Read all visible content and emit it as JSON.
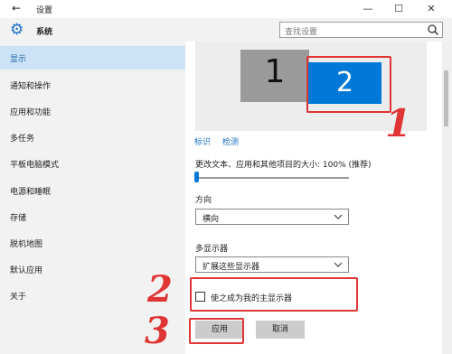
{
  "window": {
    "title": "设置",
    "back_glyph": "←",
    "min_glyph": "—",
    "max_glyph": "☐",
    "close_glyph": "✕"
  },
  "header": {
    "page_title": "系统",
    "gear_glyph": "⚙"
  },
  "search": {
    "placeholder": "查找设置"
  },
  "sidebar": {
    "items": [
      {
        "label": "显示",
        "active": true
      },
      {
        "label": "通知和操作",
        "active": false
      },
      {
        "label": "应用和功能",
        "active": false
      },
      {
        "label": "多任务",
        "active": false
      },
      {
        "label": "平板电脑模式",
        "active": false
      },
      {
        "label": "电源和睡眠",
        "active": false
      },
      {
        "label": "存储",
        "active": false
      },
      {
        "label": "脱机地图",
        "active": false
      },
      {
        "label": "默认应用",
        "active": false
      },
      {
        "label": "关于",
        "active": false
      }
    ]
  },
  "display": {
    "monitors": [
      {
        "number": "1"
      },
      {
        "number": "2"
      }
    ],
    "identify_link": "标识",
    "detect_link": "检测",
    "scale_label": "更改文本、应用和其他项目的大小: 100% (推荐)",
    "scale_slider_value": 0,
    "orientation_label": "方向",
    "orientation_value": "横向",
    "multi_display_label": "多显示器",
    "multi_display_value": "扩展这些显示器",
    "main_display_checkbox_label": "使之成为我的主显示器",
    "main_display_checked": false,
    "apply_button": "应用",
    "cancel_button": "取消"
  },
  "annotations": {
    "one": "1",
    "two": "2",
    "three": "3",
    "color": "#e03535"
  },
  "colors": {
    "accent": "#0078d7",
    "sidebar_bg": "#f2f2f2",
    "active_bg": "#cce2f6",
    "link": "#1a6fc6"
  }
}
